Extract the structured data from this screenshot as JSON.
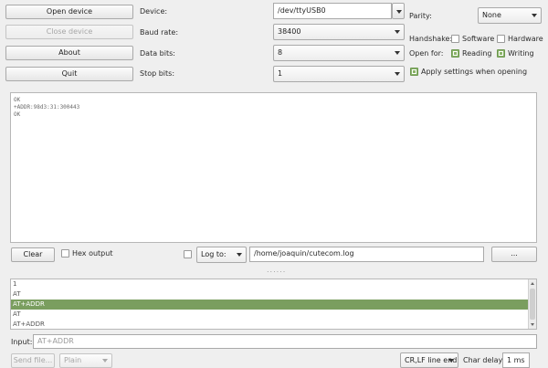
{
  "buttons": {
    "open_device": "Open device",
    "close_device": "Close device",
    "about": "About",
    "quit": "Quit",
    "clear": "Clear",
    "browse": "...",
    "send_file": "Send file..."
  },
  "settings": {
    "device_label": "Device:",
    "device_value": "/dev/ttyUSB0",
    "baud_label": "Baud rate:",
    "baud_value": "38400",
    "data_bits_label": "Data bits:",
    "data_bits_value": "8",
    "stop_bits_label": "Stop bits:",
    "stop_bits_value": "1",
    "parity_label": "Parity:",
    "parity_value": "None",
    "handshake_label": "Handshake:",
    "handshake_software": "Software",
    "handshake_hardware": "Hardware",
    "software_checked": false,
    "hardware_checked": false,
    "open_for_label": "Open for:",
    "reading": "Reading",
    "writing": "Writing",
    "reading_checked": true,
    "writing_checked": true,
    "apply_label": "Apply settings when opening",
    "apply_checked": true
  },
  "output": {
    "lines": [
      "OK",
      "+ADDR:98d3:31:300443",
      "OK"
    ]
  },
  "log": {
    "hex_output_label": "Hex output",
    "hex_checked": false,
    "log_checked": false,
    "log_mode": "Log to:",
    "log_path": "/home/joaquin/cutecom.log"
  },
  "splitter": "......",
  "history": {
    "items": [
      "1",
      "AT",
      "AT+ADDR",
      "AT",
      "AT+ADDR"
    ],
    "selected_index": 2
  },
  "input": {
    "label": "Input:",
    "placeholder": "AT+ADDR"
  },
  "bottom": {
    "format": "Plain",
    "line_end": "CR,LF line end",
    "char_delay_label": "Char delay:",
    "char_delay_value": "1 ms"
  }
}
